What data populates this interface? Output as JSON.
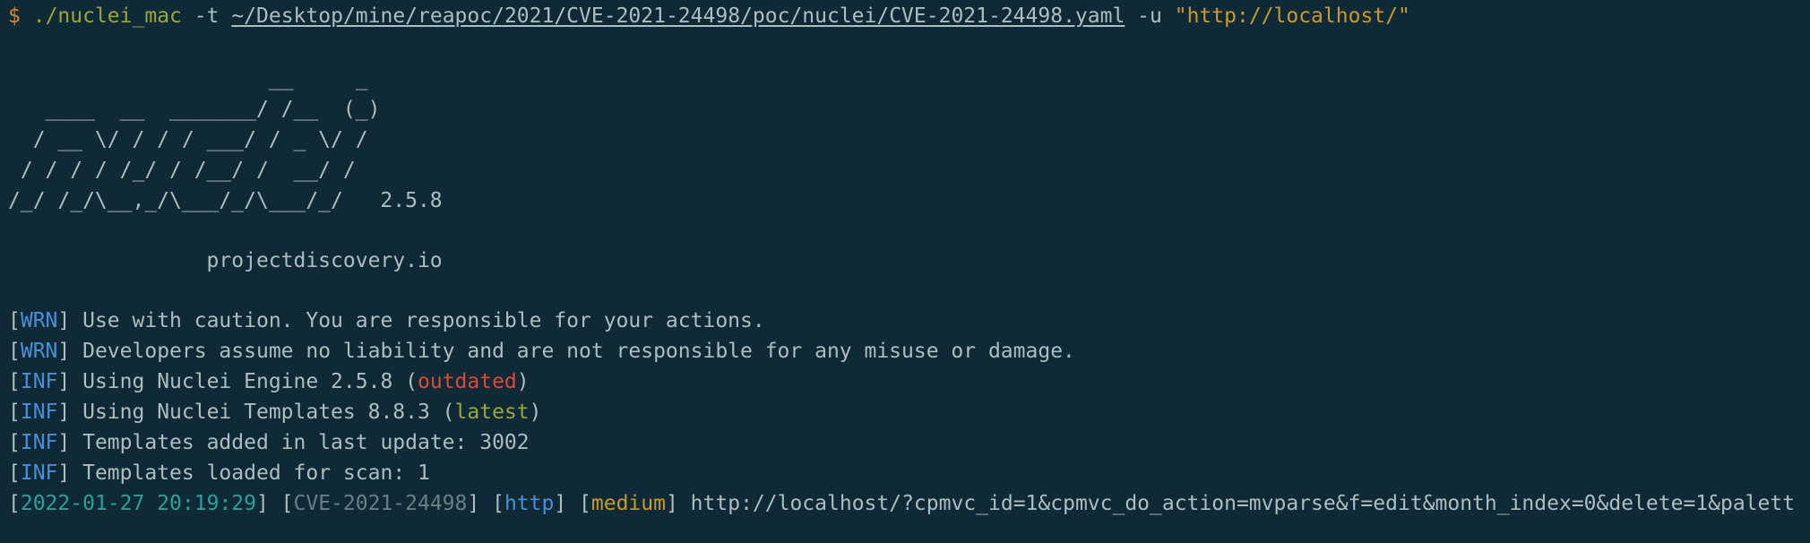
{
  "command": {
    "prompt": "$",
    "binary": "./nuclei_mac",
    "flag_t": "-t",
    "template_path": "~/Desktop/mine/reapoc/2021/CVE-2021-24498/poc/nuclei/CVE-2021-24498.yaml",
    "flag_u": "-u",
    "url": "\"http://localhost/\""
  },
  "banner": {
    "ascii": [
      "                     __     _",
      "   ____  __  _______/ /__  (_)",
      "  / __ \\/ / / / ___/ / _ \\/ /",
      " / / / / /_/ / /__/ /  __/ /",
      "/_/ /_/\\__,_/\\___/_/\\___/_/   2.5.8"
    ],
    "site": "                projectdiscovery.io"
  },
  "logs": [
    {
      "tag": "WRN",
      "text": " Use with caution. You are responsible for your actions."
    },
    {
      "tag": "WRN",
      "text": " Developers assume no liability and are not responsible for any misuse or damage."
    },
    {
      "tag": "INF",
      "text": " Using Nuclei Engine 2.5.8 (",
      "highlight": "outdated",
      "suffix": ")"
    },
    {
      "tag": "INF",
      "text": " Using Nuclei Templates 8.8.3 (",
      "highlight": "latest",
      "suffix": ")"
    },
    {
      "tag": "INF",
      "text": " Templates added in last update: 3002"
    },
    {
      "tag": "INF",
      "text": " Templates loaded for scan: 1"
    }
  ],
  "result": {
    "timestamp": "2022-01-27 20:19:29",
    "template_id": "CVE-2021-24498",
    "protocol": "http",
    "severity": "medium",
    "matched_url": " http://localhost/?cpmvc_id=1&cpmvc_do_action=mvparse&f=edit&month_index=0&delete=1&palett"
  },
  "colors": {
    "background": "#0f2a36",
    "text": "#aebdc0",
    "prompt": "#d08a3a",
    "binary": "#9aa63a",
    "string": "#c79a2a",
    "tag": "#4a8fd6",
    "timestamp": "#2aa198",
    "template_id": "#6a7f85",
    "outdated": "#d84a3c",
    "latest": "#9aa63a"
  }
}
